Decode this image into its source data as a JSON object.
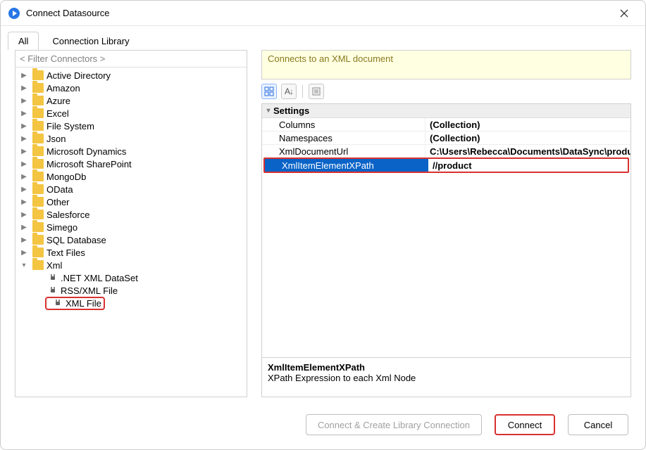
{
  "window": {
    "title": "Connect Datasource"
  },
  "tabs": {
    "all": "All",
    "library": "Connection Library"
  },
  "filter": {
    "placeholder": "< Filter Connectors >"
  },
  "tree": {
    "items": [
      {
        "label": "Active Directory"
      },
      {
        "label": "Amazon"
      },
      {
        "label": "Azure"
      },
      {
        "label": "Excel"
      },
      {
        "label": "File System"
      },
      {
        "label": "Json"
      },
      {
        "label": "Microsoft Dynamics"
      },
      {
        "label": "Microsoft SharePoint"
      },
      {
        "label": "MongoDb"
      },
      {
        "label": "OData"
      },
      {
        "label": "Other"
      },
      {
        "label": "Salesforce"
      },
      {
        "label": "Simego"
      },
      {
        "label": "SQL Database"
      },
      {
        "label": "Text Files"
      }
    ],
    "xml": {
      "label": "Xml",
      "children": [
        {
          "label": ".NET XML DataSet"
        },
        {
          "label": "RSS/XML File"
        },
        {
          "label": "XML File"
        }
      ]
    }
  },
  "description": "Connects to an XML document",
  "settings": {
    "category": "Settings",
    "rows": [
      {
        "name": "Columns",
        "value": "(Collection)"
      },
      {
        "name": "Namespaces",
        "value": "(Collection)"
      },
      {
        "name": "XmlDocumentUrl",
        "value": "C:\\Users\\Rebecca\\Documents\\DataSync\\produc"
      },
      {
        "name": "XmlItemElementXPath",
        "value": "//product"
      }
    ]
  },
  "footer": {
    "title": "XmlItemElementXPath",
    "desc": "XPath Expression to each Xml Node"
  },
  "buttons": {
    "createlib": "Connect & Create Library Connection",
    "connect": "Connect",
    "cancel": "Cancel"
  }
}
